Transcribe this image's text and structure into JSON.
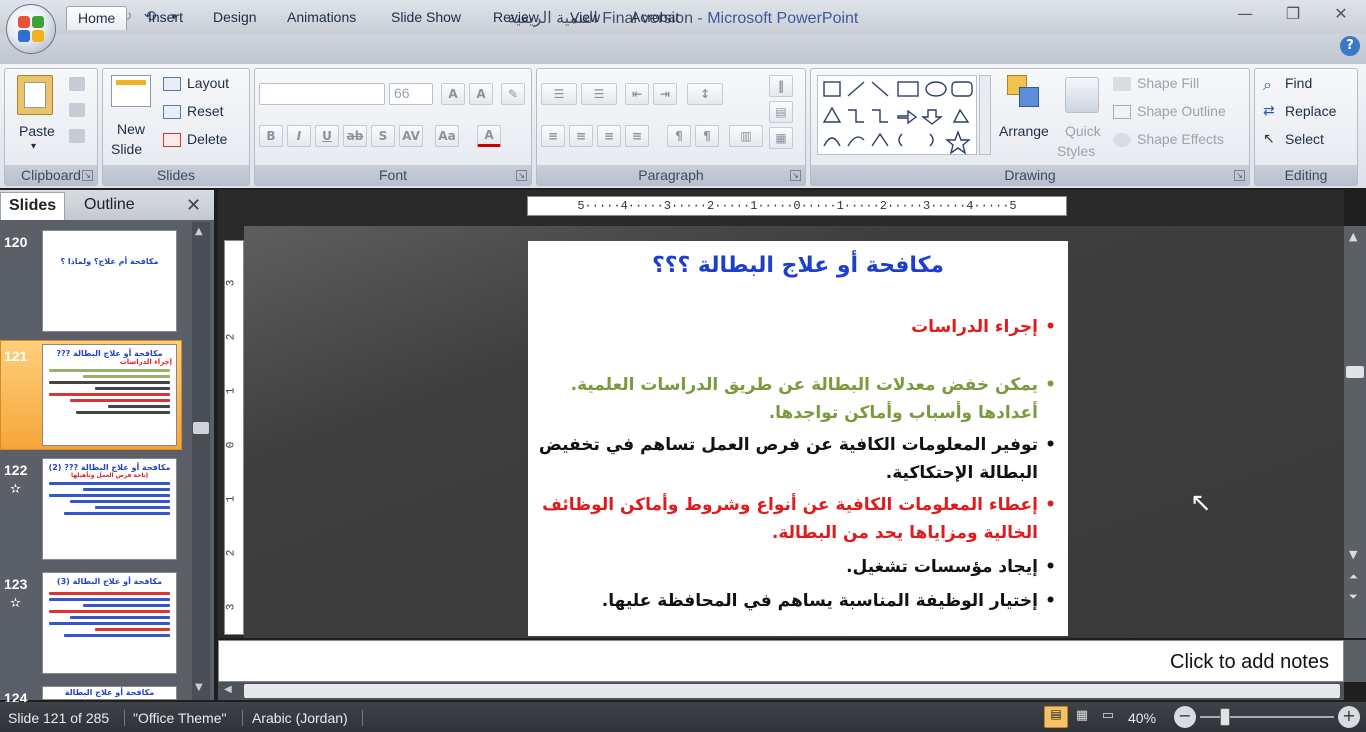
{
  "window": {
    "title_arabic": "التنمية الريفية",
    "title_main": "Final version",
    "title_app": "- Microsoft PowerPoint",
    "controls": [
      "—",
      "❐",
      "✕"
    ]
  },
  "qat": {
    "icons": [
      "save-icon",
      "undo-icon",
      "redo-icon",
      "repeat-icon",
      "customize-icon"
    ]
  },
  "tabs": [
    "Home",
    "Insert",
    "Design",
    "Animations",
    "Slide Show",
    "Review",
    "View",
    "Acrobat"
  ],
  "ribbon": {
    "clipboard": {
      "label": "Clipboard",
      "paste": "Paste"
    },
    "slides": {
      "label": "Slides",
      "new_slide_1": "New",
      "new_slide_2": "Slide",
      "layout": "Layout",
      "reset": "Reset",
      "delete": "Delete"
    },
    "font": {
      "label": "Font",
      "font_name": "",
      "font_size": "66"
    },
    "paragraph": {
      "label": "Paragraph"
    },
    "drawing": {
      "label": "Drawing",
      "arrange": "Arrange",
      "quick_styles_1": "Quick",
      "quick_styles_2": "Styles",
      "shape_fill": "Shape Fill",
      "shape_outline": "Shape Outline",
      "shape_effects": "Shape Effects"
    },
    "editing": {
      "label": "Editing",
      "find": "Find",
      "replace": "Replace",
      "select": "Select"
    }
  },
  "panel": {
    "tab_slides": "Slides",
    "tab_outline": "Outline",
    "thumbs": [
      {
        "num": "120",
        "title": "مكافحة أم علاج؟ ولماذا ؟"
      },
      {
        "num": "121",
        "title": "مكافحة أو علاج البطالة ???",
        "sub": "إجراء الدراسات"
      },
      {
        "num": "122",
        "title": "مكافحة أو علاج البطالة ??? (2)",
        "sub": "إتاحة فرص العمل وتأهيلها"
      },
      {
        "num": "123",
        "title": "مكافحة أو علاج البطالة (3)"
      },
      {
        "num": "124",
        "title": "مكافحة أو علاج البطالة"
      }
    ]
  },
  "ruler": {
    "text": "5·····4·····3·····2·····1·····0·····1·····2·····3·····4·····5",
    "v_marks": [
      "3",
      "2",
      "1",
      "0",
      "1",
      "2",
      "3"
    ]
  },
  "slide": {
    "title": "مكافحة  أو علاج البطالة   ؟؟؟",
    "bullets": [
      {
        "text": "إجراء الدراسات",
        "color": "#e11b1b"
      },
      {
        "text": "يمكن خفض معدلات البطالة عن طريق الدراسات العلمية. أعدادها وأسباب وأماكن تواجدها.",
        "color": "#7a9a3c"
      },
      {
        "text": "توفير المعلومات الكافية عن فرص العمل تساهم في تخفيض البطالة الإحتكاكية.",
        "color": "#111111"
      },
      {
        "text": "إعطاء المعلومات الكافية عن أنواع وشروط وأماكن الوظائف الخالية ومزاياها يحد من البطالة.",
        "color": "#e11b1b"
      },
      {
        "text": "إيجاد مؤسسات تشغيل.",
        "color": "#111111"
      },
      {
        "text": "إختيار الوظيفة المناسبة يساهم في المحافظة عليها.",
        "color": "#111111"
      }
    ]
  },
  "notes": {
    "placeholder": "Click to add notes"
  },
  "status": {
    "slide": "Slide 121 of 285",
    "theme": "\"Office Theme\"",
    "language": "Arabic (Jordan)",
    "zoom": "40%"
  }
}
